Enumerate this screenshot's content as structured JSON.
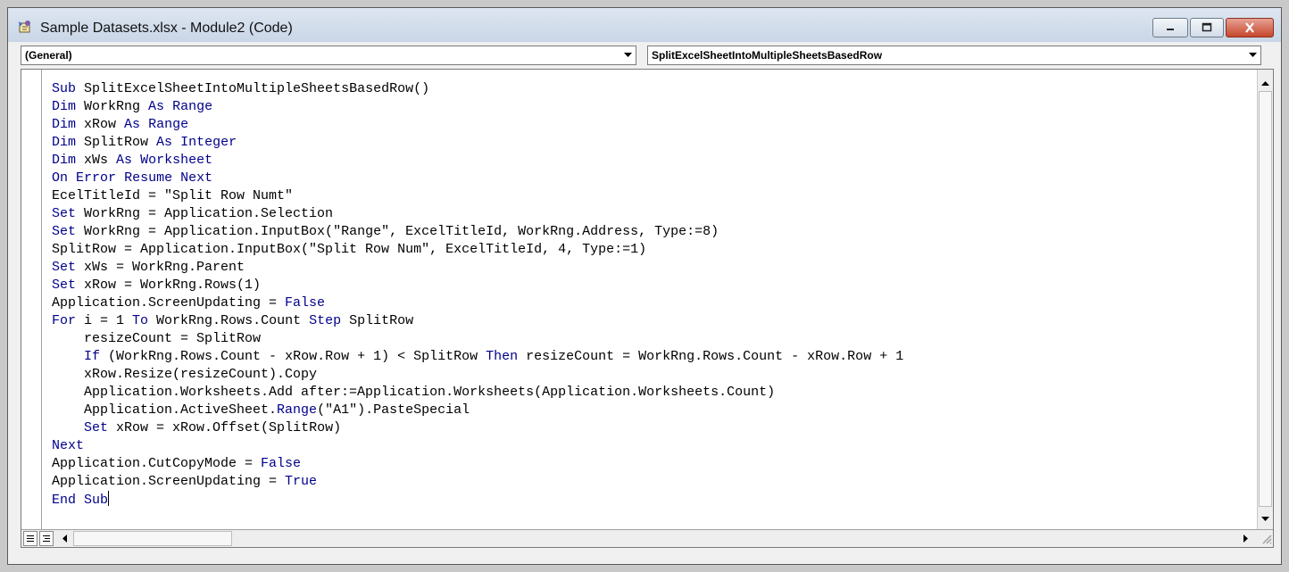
{
  "window": {
    "title": "Sample Datasets.xlsx - Module2 (Code)",
    "icon": "vba-module-icon",
    "buttons": [
      "minimize-icon",
      "maximize-icon",
      "close-icon"
    ]
  },
  "object_combo": {
    "value": "(General)"
  },
  "procedure_combo": {
    "value": "SplitExcelSheetIntoMultipleSheetsBasedRow"
  },
  "colors": {
    "keyword": "#00008b",
    "text": "#000000"
  },
  "code": {
    "lines": [
      "Sub SplitExcelSheetIntoMultipleSheetsBasedRow()",
      "Dim WorkRng As Range",
      "Dim xRow As Range",
      "Dim SplitRow As Integer",
      "Dim xWs As Worksheet",
      "On Error Resume Next",
      "EcelTitleId = \"Split Row Numt\"",
      "Set WorkRng = Application.Selection",
      "Set WorkRng = Application.InputBox(\"Range\", ExcelTitleId, WorkRng.Address, Type:=8)",
      "SplitRow = Application.InputBox(\"Split Row Num\", ExcelTitleId, 4, Type:=1)",
      "Set xWs = WorkRng.Parent",
      "Set xRow = WorkRng.Rows(1)",
      "Application.ScreenUpdating = False",
      "For i = 1 To WorkRng.Rows.Count Step SplitRow",
      "    resizeCount = SplitRow",
      "    If (WorkRng.Rows.Count - xRow.Row + 1) < SplitRow Then resizeCount = WorkRng.Rows.Count - xRow.Row + 1",
      "    xRow.Resize(resizeCount).Copy",
      "    Application.Worksheets.Add after:=Application.Worksheets(Application.Worksheets.Count)",
      "    Application.ActiveSheet.Range(\"A1\").PasteSpecial",
      "    Set xRow = xRow.Offset(SplitRow)",
      "Next",
      "Application.CutCopyMode = False",
      "Application.ScreenUpdating = True",
      "End Sub"
    ]
  }
}
